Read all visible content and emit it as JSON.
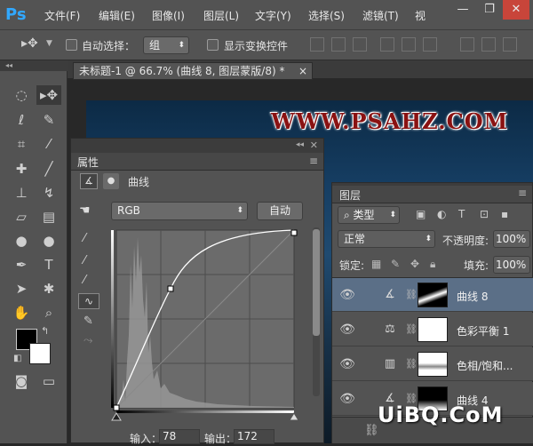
{
  "app": {
    "logo": "Ps"
  },
  "menubar": {
    "items": [
      "文件(F)",
      "编辑(E)",
      "图像(I)",
      "图层(L)",
      "文字(Y)",
      "选择(S)",
      "滤镜(T)",
      "视"
    ]
  },
  "options": {
    "auto_select_label": "自动选择：",
    "auto_select_value": "组",
    "show_transform_label": "显示变换控件"
  },
  "document": {
    "tab_title": "未标题-1 @ 66.7% (曲线 8, 图层蒙版/8) *",
    "close": "×",
    "watermark": "WWW.PSAHZ.COM"
  },
  "properties": {
    "title": "属性",
    "adjustment_name": "曲线",
    "channel": "RGB",
    "auto_button": "自动",
    "input_label": "输入：",
    "input_value": "78",
    "output_label": "输出：",
    "output_value": "172"
  },
  "layers": {
    "title": "图层",
    "filter_kind": "类型",
    "blend_mode": "正常",
    "opacity_label": "不透明度:",
    "opacity_value": "100%",
    "lock_label": "锁定:",
    "fill_label": "填充:",
    "fill_value": "100%",
    "items": [
      {
        "name": "曲线 8",
        "selected": true
      },
      {
        "name": "色彩平衡 1",
        "selected": false
      },
      {
        "name": "色相/饱和...",
        "selected": false
      },
      {
        "name": "曲线 4",
        "selected": false
      }
    ]
  },
  "footer_watermark": "UiBQ.CoM"
}
